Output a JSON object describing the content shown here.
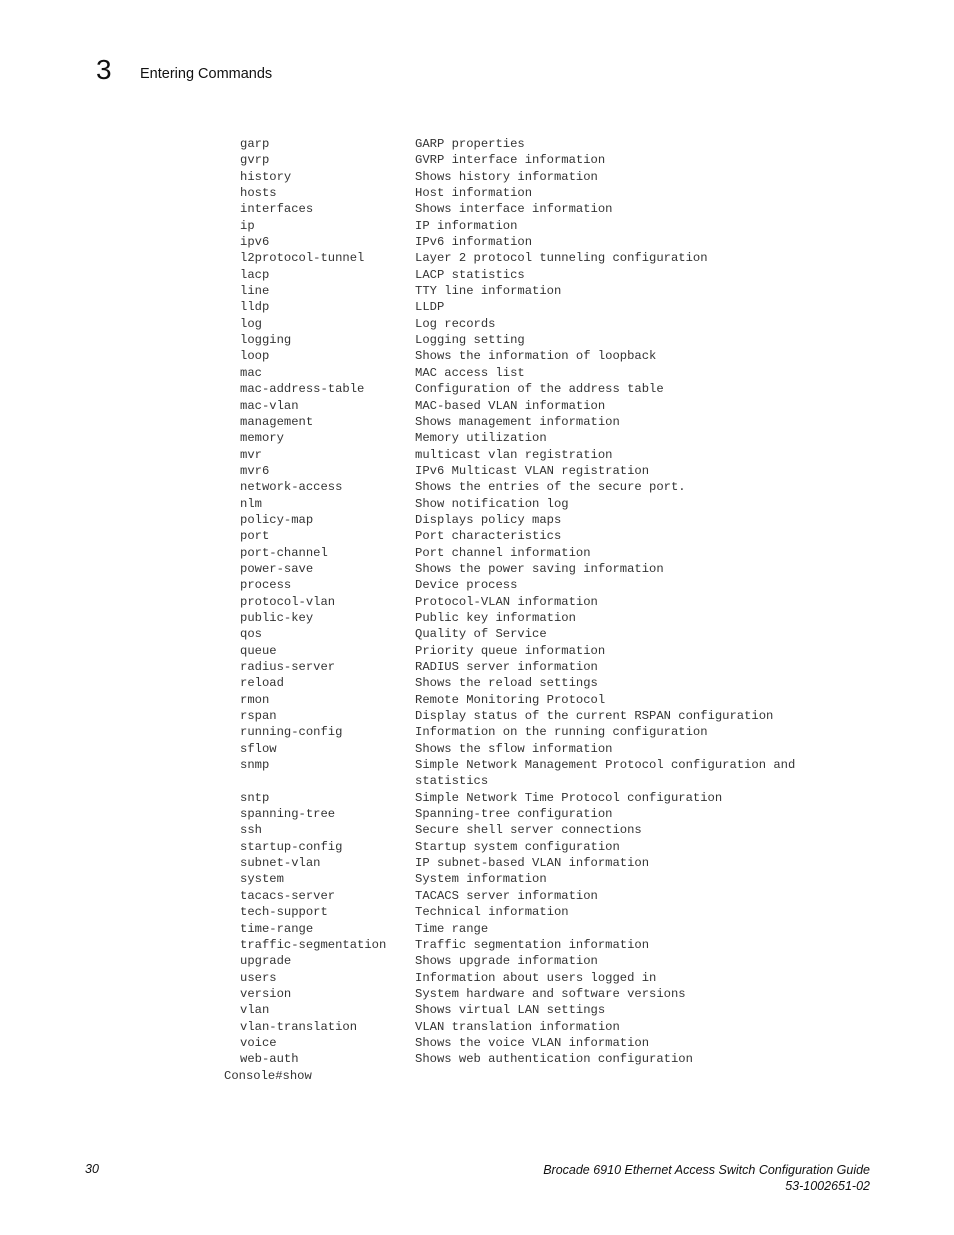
{
  "header": {
    "chapter_number": "3",
    "chapter_title": "Entering Commands"
  },
  "commands": [
    {
      "cmd": "garp",
      "desc": "GARP properties"
    },
    {
      "cmd": "gvrp",
      "desc": "GVRP interface information"
    },
    {
      "cmd": "history",
      "desc": "Shows history information"
    },
    {
      "cmd": "hosts",
      "desc": "Host information"
    },
    {
      "cmd": "interfaces",
      "desc": "Shows interface information"
    },
    {
      "cmd": "ip",
      "desc": "IP information"
    },
    {
      "cmd": "ipv6",
      "desc": "IPv6 information"
    },
    {
      "cmd": "l2protocol-tunnel",
      "desc": "Layer 2 protocol tunneling configuration"
    },
    {
      "cmd": "lacp",
      "desc": "LACP statistics"
    },
    {
      "cmd": "line",
      "desc": "TTY line information"
    },
    {
      "cmd": "lldp",
      "desc": "LLDP"
    },
    {
      "cmd": "log",
      "desc": "Log records"
    },
    {
      "cmd": "logging",
      "desc": "Logging setting"
    },
    {
      "cmd": "loop",
      "desc": "Shows the information of loopback"
    },
    {
      "cmd": "mac",
      "desc": "MAC access list"
    },
    {
      "cmd": "mac-address-table",
      "desc": "Configuration of the address table"
    },
    {
      "cmd": "mac-vlan",
      "desc": "MAC-based VLAN information"
    },
    {
      "cmd": "management",
      "desc": "Shows management information"
    },
    {
      "cmd": "memory",
      "desc": "Memory utilization"
    },
    {
      "cmd": "mvr",
      "desc": "multicast vlan registration"
    },
    {
      "cmd": "mvr6",
      "desc": "IPv6 Multicast VLAN registration"
    },
    {
      "cmd": "network-access",
      "desc": "Shows the entries of the secure port."
    },
    {
      "cmd": "nlm",
      "desc": "Show notification log"
    },
    {
      "cmd": "policy-map",
      "desc": "Displays policy maps"
    },
    {
      "cmd": "port",
      "desc": "Port characteristics"
    },
    {
      "cmd": "port-channel",
      "desc": "Port channel information"
    },
    {
      "cmd": "power-save",
      "desc": "Shows the power saving information"
    },
    {
      "cmd": "process",
      "desc": "Device process"
    },
    {
      "cmd": "protocol-vlan",
      "desc": "Protocol-VLAN information"
    },
    {
      "cmd": "public-key",
      "desc": "Public key information"
    },
    {
      "cmd": "qos",
      "desc": "Quality of Service"
    },
    {
      "cmd": "queue",
      "desc": "Priority queue information"
    },
    {
      "cmd": "radius-server",
      "desc": "RADIUS server information"
    },
    {
      "cmd": "reload",
      "desc": "Shows the reload settings"
    },
    {
      "cmd": "rmon",
      "desc": "Remote Monitoring Protocol"
    },
    {
      "cmd": "rspan",
      "desc": "Display status of the current RSPAN configuration"
    },
    {
      "cmd": "running-config",
      "desc": "Information on the running configuration"
    },
    {
      "cmd": "sflow",
      "desc": "Shows the sflow information"
    },
    {
      "cmd": "snmp",
      "desc": "Simple Network Management Protocol configuration and",
      "desc_cont": "statistics"
    },
    {
      "cmd": "sntp",
      "desc": "Simple Network Time Protocol configuration"
    },
    {
      "cmd": "spanning-tree",
      "desc": "Spanning-tree configuration"
    },
    {
      "cmd": "ssh",
      "desc": "Secure shell server connections"
    },
    {
      "cmd": "startup-config",
      "desc": "Startup system configuration"
    },
    {
      "cmd": "subnet-vlan",
      "desc": "IP subnet-based VLAN information"
    },
    {
      "cmd": "system",
      "desc": "System information"
    },
    {
      "cmd": "tacacs-server",
      "desc": "TACACS server information"
    },
    {
      "cmd": "tech-support",
      "desc": "Technical information"
    },
    {
      "cmd": "time-range",
      "desc": "Time range"
    },
    {
      "cmd": "traffic-segmentation",
      "desc": "Traffic segmentation information"
    },
    {
      "cmd": "upgrade",
      "desc": "Shows upgrade information"
    },
    {
      "cmd": "users",
      "desc": "Information about users logged in"
    },
    {
      "cmd": "version",
      "desc": "System hardware and software versions"
    },
    {
      "cmd": "vlan",
      "desc": "Shows virtual LAN settings"
    },
    {
      "cmd": "vlan-translation",
      "desc": "VLAN translation information"
    },
    {
      "cmd": "voice",
      "desc": "Shows the voice VLAN information"
    },
    {
      "cmd": "web-auth",
      "desc": "Shows web authentication configuration"
    }
  ],
  "prompt": "Console#show",
  "footer": {
    "page_number": "30",
    "doc_title": "Brocade 6910 Ethernet Access Switch Configuration Guide",
    "doc_number": "53-1002651-02"
  }
}
